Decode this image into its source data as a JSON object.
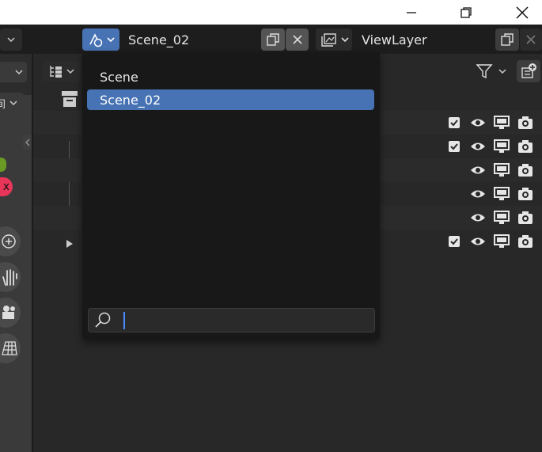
{
  "window": {
    "minimize_icon": "minimize-icon",
    "maximize_icon": "maximize-icon",
    "close_icon": "close-icon"
  },
  "topbar": {
    "scene_browse_icon": "scene-browse-icon",
    "scene_name": "Scene_02",
    "scene_new_icon": "duplicate-icon",
    "scene_delete_icon": "close-icon",
    "viewlayer_browse_icon": "render-layers-icon",
    "viewlayer_name": "ViewLayer",
    "viewlayer_new_icon": "duplicate-icon",
    "viewlayer_delete_icon": "close-icon"
  },
  "scene_dropdown": {
    "items": [
      {
        "label": "Scene",
        "selected": false
      },
      {
        "label": "Scene_02",
        "selected": true
      }
    ],
    "search_value": "",
    "highlight_color": "#4772b3"
  },
  "left_panel": {
    "half_label": "间"
  },
  "outliner": {
    "rows": [
      {
        "checkbox": true
      },
      {
        "checkbox": true
      },
      {
        "checkbox": false
      },
      {
        "checkbox": false
      },
      {
        "checkbox": false
      },
      {
        "checkbox": true
      }
    ]
  }
}
